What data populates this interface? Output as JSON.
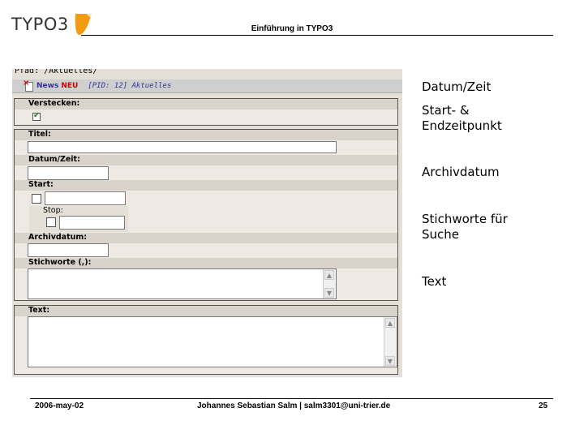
{
  "header": {
    "logo_text": "TYPO3",
    "title": "Einführung in TYPO3"
  },
  "screenshot": {
    "breadcrumb": "Pfad: /Aktuelles/",
    "record": {
      "name": "News",
      "new_badge": "NEU",
      "pid": "[PID: 12] Aktuelles"
    },
    "fields": {
      "hide_label": "Verstecken:",
      "hide_checked": true,
      "title_label": "Titel:",
      "datetime_label": "Datum/Zeit:",
      "start_label": "Start:",
      "stop_label": "Stop:",
      "archive_label": "Archivdatum:",
      "keywords_label": "Stichworte (,):",
      "text_label": "Text:"
    }
  },
  "notes": {
    "datetime": "Datum/Zeit",
    "startstop": "Start- & Endzeitpunkt",
    "archive": "Archivdatum",
    "keywords": "Stichworte für Suche",
    "text": "Text"
  },
  "footer": {
    "date": "2006-may-02",
    "author": "Johannes Sebastian Salm | salm3301@uni-trier.de",
    "page": "25"
  },
  "colors": {
    "logo_orange": "#f39c12",
    "record_blue": "#333399",
    "new_red": "#cc0000"
  }
}
